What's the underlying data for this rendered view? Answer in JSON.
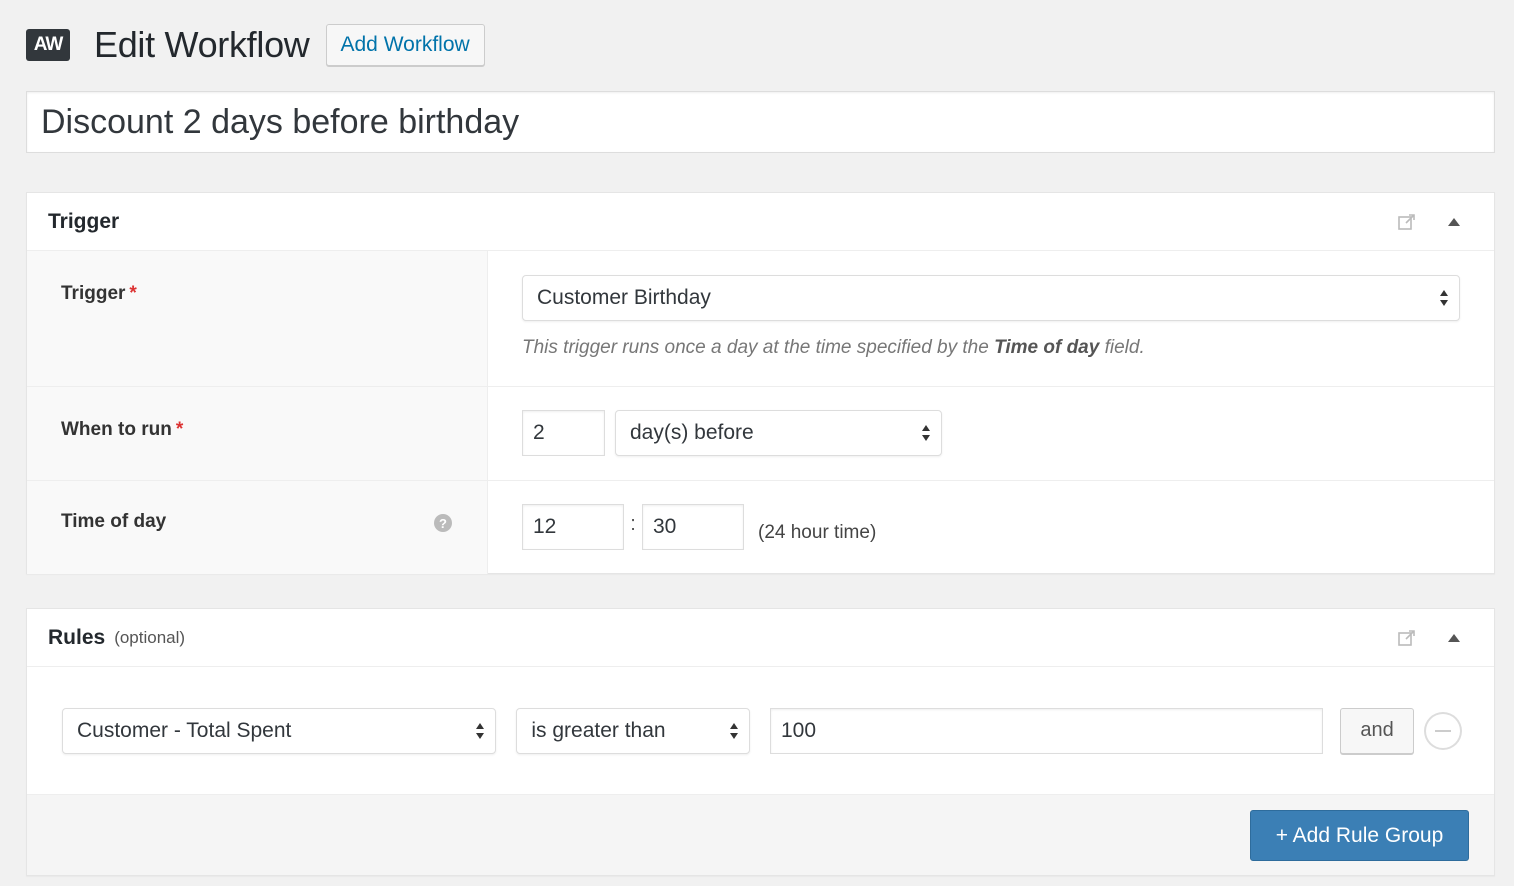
{
  "header": {
    "logo_text": "AW",
    "title": "Edit Workflow",
    "add_button_label": "Add Workflow"
  },
  "workflow": {
    "title_value": "Discount 2 days before birthday"
  },
  "trigger_panel": {
    "title": "Trigger",
    "fields": {
      "trigger": {
        "label": "Trigger",
        "required_mark": "*",
        "value": "Customer Birthday",
        "description_prefix": "This trigger runs once a day at the time specified by the ",
        "description_bold": "Time of day",
        "description_suffix": " field."
      },
      "when_to_run": {
        "label": "When to run",
        "required_mark": "*",
        "amount": "2",
        "unit": "day(s) before"
      },
      "time_of_day": {
        "label": "Time of day",
        "help_glyph": "?",
        "hour": "12",
        "separator": ":",
        "minute": "30",
        "hint": "(24 hour time)"
      }
    }
  },
  "rules_panel": {
    "title": "Rules",
    "subtitle": "(optional)",
    "rule": {
      "field": "Customer - Total Spent",
      "operator": "is greater than",
      "value": "100",
      "and_label": "and"
    },
    "add_group_label": "+ Add Rule Group"
  },
  "colors": {
    "background": "#f1f1f1",
    "link": "#0073aa",
    "primary_button": "#3b7fb5",
    "required": "#dc3232"
  },
  "icons": [
    "external-link-icon",
    "collapse-arrow-icon",
    "help-icon",
    "select-arrows-icon",
    "remove-circle-icon"
  ]
}
